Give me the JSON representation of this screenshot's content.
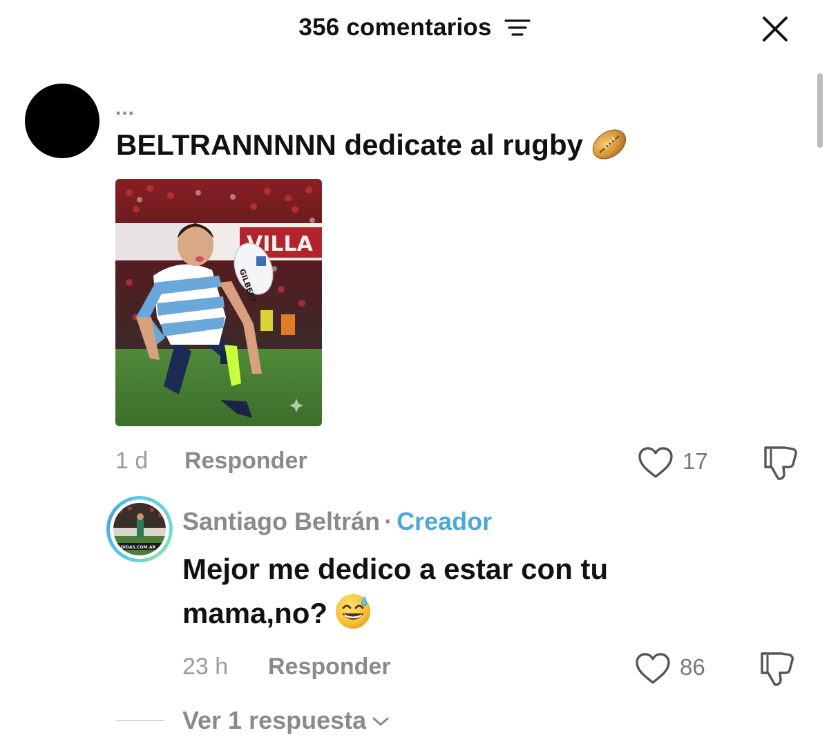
{
  "header": {
    "title": "356 comentarios",
    "sort_icon": "sort-lines-icon",
    "close_icon": "close-icon"
  },
  "comments": [
    {
      "username": "...",
      "text": "BELTRANNNNN dedicate al rugby",
      "emoji": "rugby-ball-emoji",
      "has_image": true,
      "time": "1 d",
      "reply_label": "Responder",
      "likes": "17"
    }
  ],
  "reply": {
    "username": "Santiago Beltrán",
    "separator": "·",
    "badge": "Creador",
    "text": "Mejor me dedico a estar con tu mama,no?",
    "emoji": "grinning-sweat-emoji",
    "time": "23 h",
    "reply_label": "Responder",
    "likes": "86"
  },
  "view_replies": {
    "label": "Ver 1 respuesta"
  },
  "colors": {
    "creator_badge": "#4da8d8",
    "muted_text": "#8a8a8a",
    "primary_text": "#111111",
    "avatar_ring": "#5ec7e8"
  }
}
